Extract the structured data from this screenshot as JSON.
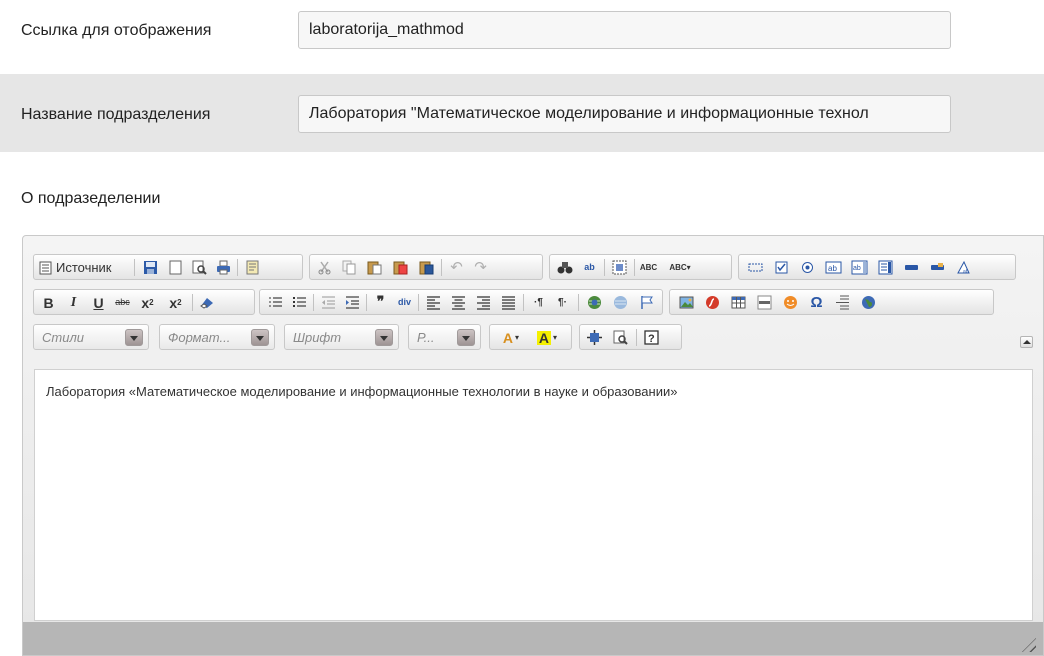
{
  "fields": {
    "link_label": "Ссылка для отображения",
    "link_value": "laboratorija_mathmod",
    "name_label": "Название подразделения",
    "name_value": "Лаборатория \"Математическое моделирование и информационные технол"
  },
  "about_label": "О подразеделении",
  "editor": {
    "source_label": "Источник",
    "combos": {
      "styles": "Стили",
      "format": "Формат...",
      "font": "Шрифт",
      "size": "Р..."
    },
    "content": "Лаборатория «Математическое моделирование и информационные технологии в науке и образовании»"
  }
}
